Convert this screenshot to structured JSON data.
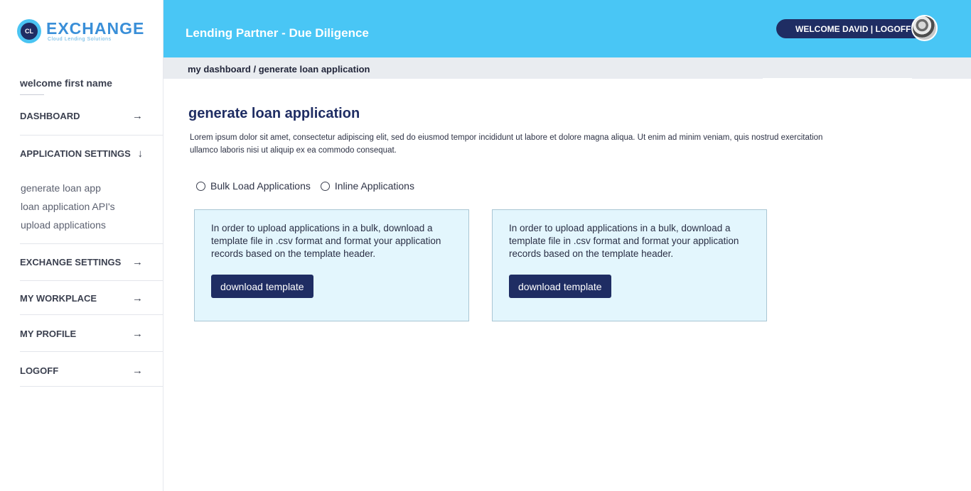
{
  "brand": {
    "logo_initials": "CL",
    "name": "EXCHANGE",
    "tagline": "Cloud Lending Solutions",
    "accent_color": "#49c6f5",
    "primary_color": "#1f2d63"
  },
  "sidebar": {
    "welcome": "welcome first name",
    "nav": [
      {
        "label": "DASHBOARD",
        "icon": "arrow-right-icon"
      },
      {
        "label": "APPLICATION SETTINGS",
        "icon": "arrow-down-icon"
      },
      {
        "label": "EXCHANGE SETTINGS",
        "icon": "arrow-right-icon"
      },
      {
        "label": "MY WORKPLACE",
        "icon": "arrow-right-icon"
      },
      {
        "label": "MY PROFILE",
        "icon": "arrow-right-icon"
      },
      {
        "label": "LOGOFF",
        "icon": "arrow-right-icon"
      }
    ],
    "sub_items": [
      {
        "label": "generate loan app"
      },
      {
        "label": "loan application API's"
      },
      {
        "label": "upload applications"
      }
    ]
  },
  "header": {
    "title": "Lending Partner - Due Diligence",
    "user_label": "WELCOME DAVID | LOGOFF"
  },
  "breadcrumb": "my dashboard / generate loan application",
  "main": {
    "title": "generate loan application",
    "description": "Lorem ipsum dolor sit amet, consectetur adipiscing elit, sed do eiusmod tempor incididunt ut labore et dolore magna aliqua. Ut enim ad minim veniam, quis nostrud exercitation ullamco laboris nisi ut aliquip ex ea commodo consequat.",
    "radio_options": [
      {
        "label": "Bulk Load Applications",
        "checked": false
      },
      {
        "label": "Inline Applications",
        "checked": false
      }
    ],
    "cards": [
      {
        "text": "In order to upload applications in a bulk, download a template file in .csv format and format your application records based on the template header.",
        "button": "download template"
      },
      {
        "text": "In order to upload applications in a bulk, download a template file in .csv format and format your application records based on the template header.",
        "button": "download template"
      }
    ]
  }
}
